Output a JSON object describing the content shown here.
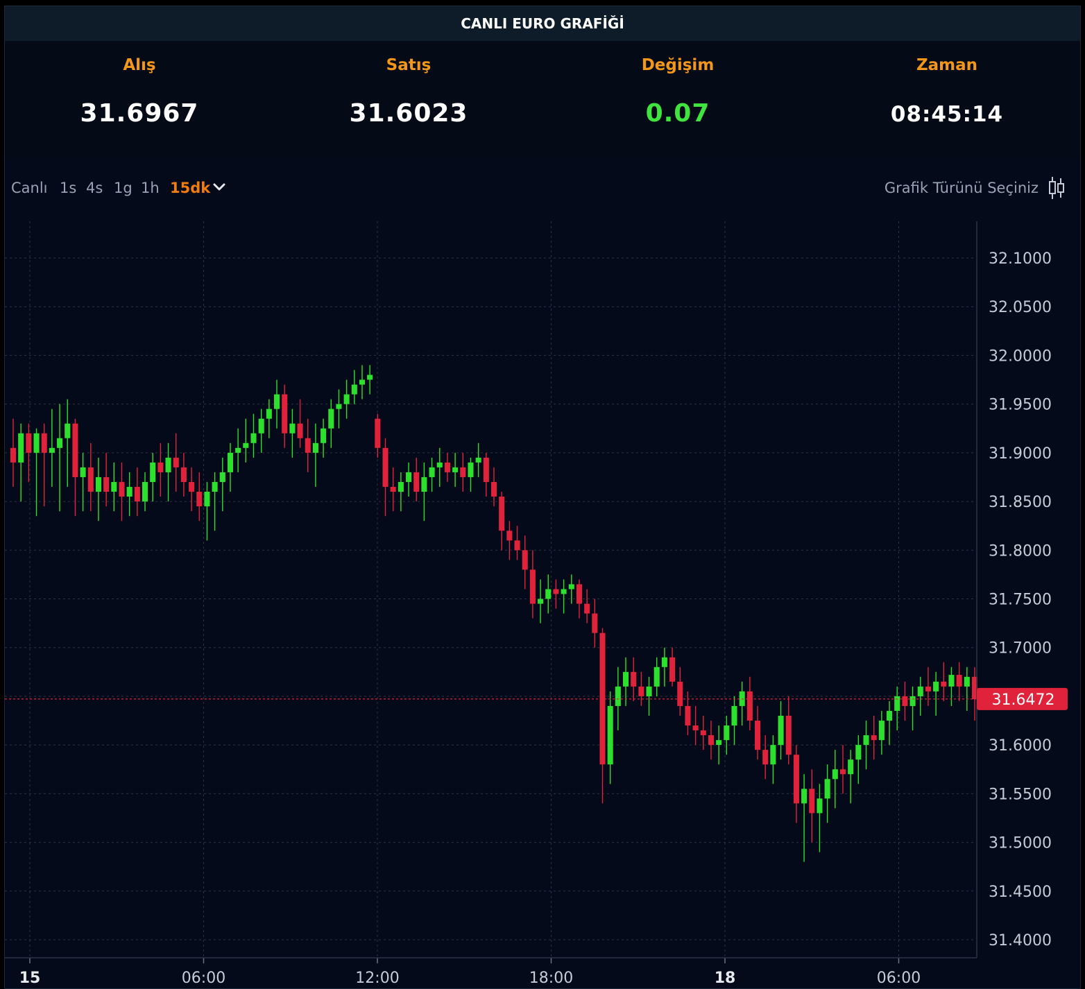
{
  "title": "CANLI EURO GRAFİĞİ",
  "quotes": [
    {
      "label": "Alış",
      "value": "31.6967"
    },
    {
      "label": "Satış",
      "value": "31.6023"
    },
    {
      "label": "Değişim",
      "value": "0.07"
    },
    {
      "label": "Zaman",
      "value": "08:45:14"
    }
  ],
  "toolbar": {
    "timeframes": [
      "Canlı",
      "1s",
      "4s",
      "1g",
      "1h",
      "15dk"
    ],
    "active_timeframe": "15dk",
    "chart_type_label": "Grafik Türünü Seçiniz"
  },
  "colors": {
    "up": "#2ee02e",
    "down": "#e0233a",
    "accent": "#f39619",
    "change_positive": "#3fe43f",
    "price_tag": "#e0233a"
  },
  "chart_data": {
    "type": "candlestick",
    "title": "",
    "grid": true,
    "y_axis_side": "right",
    "ylim": [
      31.38,
      32.14
    ],
    "y_ticks": [
      "32.1000",
      "32.0500",
      "32.0000",
      "31.9500",
      "31.9000",
      "31.8500",
      "31.8000",
      "31.7500",
      "31.7000",
      "31.6500",
      "31.6000",
      "31.5500",
      "31.5000",
      "31.4500",
      "31.4000"
    ],
    "x_ticks": [
      {
        "label": "15",
        "bold": true
      },
      {
        "label": "06:00",
        "bold": false
      },
      {
        "label": "12:00",
        "bold": false
      },
      {
        "label": "18:00",
        "bold": false
      },
      {
        "label": "18",
        "bold": true
      },
      {
        "label": "06:00",
        "bold": false
      }
    ],
    "current_price": "31.6472",
    "candles": [
      [
        31.905,
        31.935,
        31.865,
        31.89
      ],
      [
        31.89,
        31.93,
        31.85,
        31.92
      ],
      [
        31.92,
        31.93,
        31.87,
        31.9
      ],
      [
        31.9,
        31.925,
        31.835,
        31.92
      ],
      [
        31.92,
        31.93,
        31.845,
        31.9
      ],
      [
        31.9,
        31.945,
        31.865,
        31.905
      ],
      [
        31.905,
        31.95,
        31.84,
        31.915
      ],
      [
        31.915,
        31.955,
        31.865,
        31.93
      ],
      [
        31.93,
        31.935,
        31.835,
        31.875
      ],
      [
        31.875,
        31.9,
        31.84,
        31.885
      ],
      [
        31.885,
        31.91,
        31.84,
        31.86
      ],
      [
        31.86,
        31.895,
        31.83,
        31.875
      ],
      [
        31.875,
        31.9,
        31.845,
        31.86
      ],
      [
        31.86,
        31.89,
        31.84,
        31.87
      ],
      [
        31.87,
        31.89,
        31.83,
        31.855
      ],
      [
        31.855,
        31.88,
        31.835,
        31.865
      ],
      [
        31.865,
        31.885,
        31.835,
        31.85
      ],
      [
        31.85,
        31.88,
        31.84,
        31.87
      ],
      [
        31.87,
        31.9,
        31.85,
        31.89
      ],
      [
        31.89,
        31.91,
        31.855,
        31.88
      ],
      [
        31.88,
        31.91,
        31.85,
        31.895
      ],
      [
        31.895,
        31.92,
        31.86,
        31.885
      ],
      [
        31.885,
        31.9,
        31.855,
        31.87
      ],
      [
        31.87,
        31.885,
        31.84,
        31.86
      ],
      [
        31.86,
        31.88,
        31.83,
        31.845
      ],
      [
        31.845,
        31.87,
        31.81,
        31.86
      ],
      [
        31.86,
        31.88,
        31.82,
        31.87
      ],
      [
        31.87,
        31.895,
        31.84,
        31.88
      ],
      [
        31.88,
        31.91,
        31.86,
        31.9
      ],
      [
        31.9,
        31.925,
        31.88,
        31.905
      ],
      [
        31.905,
        31.935,
        31.89,
        31.91
      ],
      [
        31.91,
        31.94,
        31.895,
        31.92
      ],
      [
        31.92,
        31.945,
        31.9,
        31.935
      ],
      [
        31.935,
        31.955,
        31.915,
        31.945
      ],
      [
        31.945,
        31.975,
        31.925,
        31.96
      ],
      [
        31.96,
        31.97,
        31.905,
        31.92
      ],
      [
        31.92,
        31.945,
        31.895,
        31.93
      ],
      [
        31.93,
        31.955,
        31.905,
        31.915
      ],
      [
        31.915,
        31.935,
        31.88,
        31.9
      ],
      [
        31.9,
        31.93,
        31.865,
        31.91
      ],
      [
        31.91,
        31.935,
        31.895,
        31.925
      ],
      [
        31.925,
        31.955,
        31.905,
        31.945
      ],
      [
        31.945,
        31.965,
        31.925,
        31.95
      ],
      [
        31.95,
        31.975,
        31.935,
        31.96
      ],
      [
        31.96,
        31.985,
        31.95,
        31.97
      ],
      [
        31.97,
        31.99,
        31.955,
        31.975
      ],
      [
        31.975,
        31.99,
        31.96,
        31.98
      ],
      [
        31.935,
        31.94,
        31.895,
        31.905
      ],
      [
        31.905,
        31.915,
        31.835,
        31.865
      ],
      [
        31.865,
        31.885,
        31.84,
        31.86
      ],
      [
        31.86,
        31.88,
        31.84,
        31.87
      ],
      [
        31.87,
        31.89,
        31.855,
        31.88
      ],
      [
        31.88,
        31.895,
        31.85,
        31.86
      ],
      [
        31.86,
        31.89,
        31.83,
        31.875
      ],
      [
        31.875,
        31.895,
        31.86,
        31.885
      ],
      [
        31.885,
        31.905,
        31.865,
        31.89
      ],
      [
        31.89,
        31.9,
        31.87,
        31.88
      ],
      [
        31.88,
        31.9,
        31.865,
        31.885
      ],
      [
        31.885,
        31.9,
        31.86,
        31.875
      ],
      [
        31.875,
        31.895,
        31.86,
        31.89
      ],
      [
        31.89,
        31.91,
        31.875,
        31.895
      ],
      [
        31.895,
        31.9,
        31.855,
        31.87
      ],
      [
        31.87,
        31.885,
        31.845,
        31.855
      ],
      [
        31.855,
        31.86,
        31.8,
        31.82
      ],
      [
        31.82,
        31.83,
        31.79,
        31.81
      ],
      [
        31.81,
        31.825,
        31.79,
        31.8
      ],
      [
        31.8,
        31.815,
        31.76,
        31.78
      ],
      [
        31.78,
        31.8,
        31.73,
        31.745
      ],
      [
        31.745,
        31.77,
        31.725,
        31.75
      ],
      [
        31.75,
        31.775,
        31.735,
        31.76
      ],
      [
        31.76,
        31.77,
        31.74,
        31.755
      ],
      [
        31.755,
        31.77,
        31.735,
        31.76
      ],
      [
        31.76,
        31.775,
        31.745,
        31.765
      ],
      [
        31.765,
        31.77,
        31.73,
        31.745
      ],
      [
        31.745,
        31.76,
        31.725,
        31.735
      ],
      [
        31.735,
        31.75,
        31.7,
        31.715
      ],
      [
        31.715,
        31.72,
        31.54,
        31.58
      ],
      [
        31.58,
        31.655,
        31.56,
        31.64
      ],
      [
        31.64,
        31.68,
        31.615,
        31.66
      ],
      [
        31.66,
        31.69,
        31.64,
        31.675
      ],
      [
        31.675,
        31.69,
        31.645,
        31.66
      ],
      [
        31.66,
        31.675,
        31.64,
        31.65
      ],
      [
        31.65,
        31.67,
        31.63,
        31.66
      ],
      [
        31.66,
        31.69,
        31.65,
        31.68
      ],
      [
        31.68,
        31.7,
        31.66,
        31.69
      ],
      [
        31.69,
        31.7,
        31.66,
        31.665
      ],
      [
        31.665,
        31.68,
        31.63,
        31.64
      ],
      [
        31.64,
        31.655,
        31.61,
        31.62
      ],
      [
        31.62,
        31.64,
        31.6,
        31.615
      ],
      [
        31.615,
        31.63,
        31.595,
        31.61
      ],
      [
        31.61,
        31.625,
        31.585,
        31.6
      ],
      [
        31.6,
        31.62,
        31.58,
        31.605
      ],
      [
        31.605,
        31.63,
        31.59,
        31.62
      ],
      [
        31.62,
        31.65,
        31.6,
        31.64
      ],
      [
        31.64,
        31.665,
        31.62,
        31.655
      ],
      [
        31.655,
        31.67,
        31.615,
        31.625
      ],
      [
        31.625,
        31.64,
        31.585,
        31.595
      ],
      [
        31.595,
        31.61,
        31.565,
        31.58
      ],
      [
        31.58,
        31.61,
        31.56,
        31.6
      ],
      [
        31.6,
        31.645,
        31.585,
        31.63
      ],
      [
        31.63,
        31.65,
        31.58,
        31.59
      ],
      [
        31.59,
        31.6,
        31.52,
        31.54
      ],
      [
        31.54,
        31.57,
        31.48,
        31.555
      ],
      [
        31.555,
        31.575,
        31.5,
        31.53
      ],
      [
        31.53,
        31.56,
        31.49,
        31.545
      ],
      [
        31.545,
        31.58,
        31.52,
        31.565
      ],
      [
        31.565,
        31.595,
        31.535,
        31.575
      ],
      [
        31.575,
        31.6,
        31.55,
        31.57
      ],
      [
        31.57,
        31.595,
        31.54,
        31.585
      ],
      [
        31.585,
        31.61,
        31.56,
        31.6
      ],
      [
        31.6,
        31.625,
        31.575,
        31.61
      ],
      [
        31.61,
        31.63,
        31.585,
        31.605
      ],
      [
        31.605,
        31.635,
        31.59,
        31.625
      ],
      [
        31.625,
        31.645,
        31.6,
        31.635
      ],
      [
        31.635,
        31.66,
        31.615,
        31.65
      ],
      [
        31.65,
        31.665,
        31.625,
        31.64
      ],
      [
        31.64,
        31.66,
        31.615,
        31.65
      ],
      [
        31.65,
        31.67,
        31.63,
        31.66
      ],
      [
        31.66,
        31.68,
        31.64,
        31.655
      ],
      [
        31.655,
        31.675,
        31.63,
        31.665
      ],
      [
        31.665,
        31.685,
        31.645,
        31.66
      ],
      [
        31.66,
        31.68,
        31.64,
        31.672
      ],
      [
        31.672,
        31.685,
        31.645,
        31.66
      ],
      [
        31.66,
        31.68,
        31.635,
        31.67
      ],
      [
        31.67,
        31.68,
        31.625,
        31.647
      ]
    ]
  }
}
